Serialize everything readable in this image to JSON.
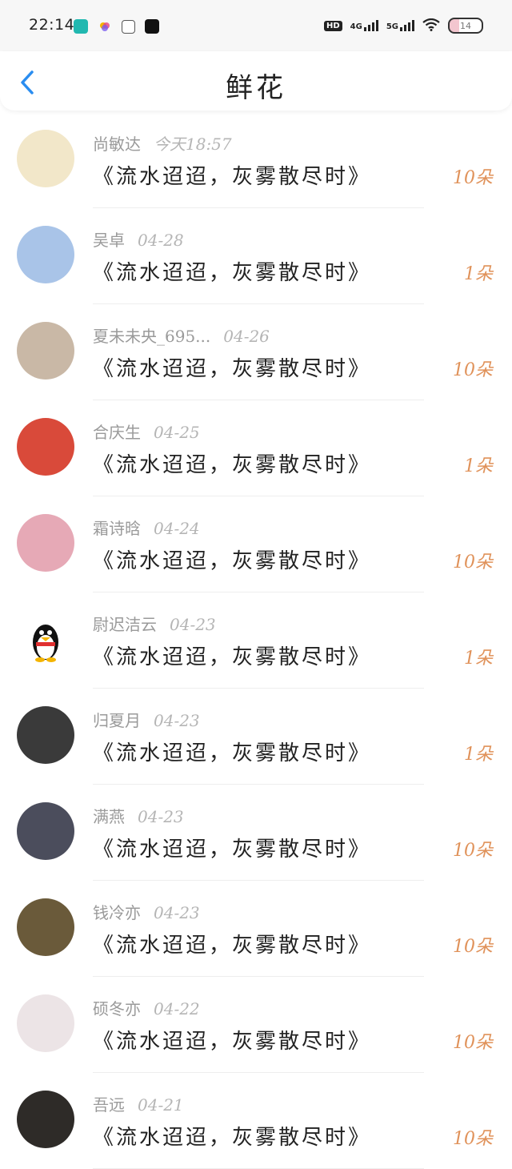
{
  "status_bar": {
    "time": "22:14",
    "apps": [
      {
        "icon": "boss-zhipin-icon",
        "label": "BOSS直聘",
        "color": "#22b8b0"
      },
      {
        "icon": "colorful-app-icon",
        "label": "",
        "color": "#f4b400"
      },
      {
        "icon": "square-app-icon",
        "label": "",
        "color": "#555555"
      },
      {
        "icon": "dewu-app-icon",
        "label": "得物",
        "color": "#111111"
      }
    ],
    "hd_label": "HD",
    "network_1": "4G",
    "network_2": "5G",
    "battery": "14"
  },
  "header": {
    "back_icon": "chevron-left-icon",
    "title": "鲜花",
    "accent": "#2a8df0"
  },
  "items": [
    {
      "name": "尚敏达",
      "date": "今天18:57",
      "message": "《流水迢迢，灰雾散尽时》",
      "amount": "10朵",
      "avatar_color": "#f2e7c9"
    },
    {
      "name": "吴卓",
      "date": "04-28",
      "message": "《流水迢迢，灰雾散尽时》",
      "amount": "1朵",
      "avatar_color": "#a9c4e8"
    },
    {
      "name": "夏未未央_695...",
      "date": "04-26",
      "message": "《流水迢迢，灰雾散尽时》",
      "amount": "10朵",
      "avatar_color": "#c9b8a6"
    },
    {
      "name": "合庆生",
      "date": "04-25",
      "message": "《流水迢迢，灰雾散尽时》",
      "amount": "1朵",
      "avatar_color": "#d94a3a"
    },
    {
      "name": "霜诗晗",
      "date": "04-24",
      "message": "《流水迢迢，灰雾散尽时》",
      "amount": "10朵",
      "avatar_color": "#e6a9b6"
    },
    {
      "name": "尉迟洁云",
      "date": "04-23",
      "message": "《流水迢迢，灰雾散尽时》",
      "amount": "1朵",
      "avatar_color": "#ffffff"
    },
    {
      "name": "归夏月",
      "date": "04-23",
      "message": "《流水迢迢，灰雾散尽时》",
      "amount": "1朵",
      "avatar_color": "#3a3a3a"
    },
    {
      "name": "满燕",
      "date": "04-23",
      "message": "《流水迢迢，灰雾散尽时》",
      "amount": "10朵",
      "avatar_color": "#4b4d5c"
    },
    {
      "name": "钱冷亦",
      "date": "04-23",
      "message": "《流水迢迢，灰雾散尽时》",
      "amount": "10朵",
      "avatar_color": "#6a5a3a"
    },
    {
      "name": "硕冬亦",
      "date": "04-22",
      "message": "《流水迢迢，灰雾散尽时》",
      "amount": "10朵",
      "avatar_color": "#ece4e6"
    },
    {
      "name": "吾远",
      "date": "04-21",
      "message": "《流水迢迢，灰雾散尽时》",
      "amount": "10朵",
      "avatar_color": "#2e2b28"
    }
  ],
  "colors": {
    "amount": "#e0925a",
    "name": "#9a9a9a"
  }
}
